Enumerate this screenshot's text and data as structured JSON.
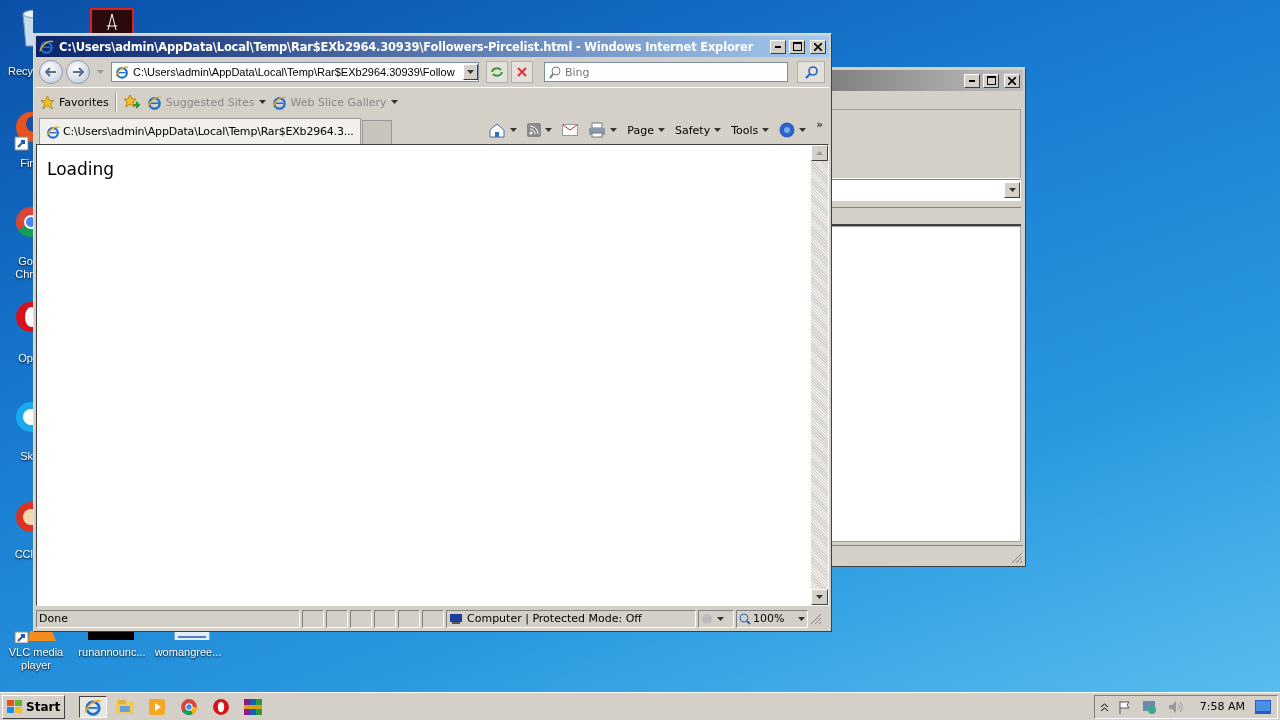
{
  "desktop_icons": [
    {
      "kind": "recycle",
      "label": "Recy"
    },
    {
      "kind": "acrobat"
    },
    {
      "kind": "firefox",
      "label": "Fir"
    },
    {
      "kind": "chrome",
      "label": "Go\nChr"
    },
    {
      "kind": "opera",
      "label": "Op"
    },
    {
      "kind": "skype",
      "label": "Sk"
    },
    {
      "kind": "ccleaner",
      "label": "CCl"
    },
    {
      "kind": "vlc",
      "label": "VLC media player"
    },
    {
      "kind": "thumb-dark",
      "label": "runannounc..."
    },
    {
      "kind": "thumb-light",
      "label": "womangree..."
    }
  ],
  "background_window": {
    "active": false
  },
  "ie_window": {
    "active": true,
    "title": "C:\\Users\\admin\\AppData\\Local\\Temp\\Rar$EXb2964.30939\\Followers-Pircelist.html - Windows Internet Explorer",
    "address": "C:\\Users\\admin\\AppData\\Local\\Temp\\Rar$EXb2964.30939\\Follow",
    "search_placeholder": "Bing",
    "favorites_bar": [
      {
        "kind": "favorites",
        "label": "Favorites"
      },
      {
        "kind": "link",
        "label": "Suggested Sites"
      },
      {
        "kind": "link",
        "label": "Web Slice Gallery"
      }
    ],
    "tabs": [
      {
        "kind": "page",
        "label": "C:\\Users\\admin\\AppData\\Local\\Temp\\Rar$EXb2964.3...",
        "selected": true
      },
      {
        "kind": "new",
        "selected": false
      }
    ],
    "command_bar": [
      {
        "kind": "home"
      },
      {
        "kind": "feeds"
      },
      {
        "kind": "mail"
      },
      {
        "kind": "print"
      },
      {
        "kind": "menu",
        "label": "Page"
      },
      {
        "kind": "menu",
        "label": "Safety"
      },
      {
        "kind": "menu",
        "label": "Tools"
      },
      {
        "kind": "help"
      },
      {
        "kind": "more",
        "label": "»"
      }
    ],
    "content": "Loading",
    "status_bar": {
      "text": "Done",
      "zone": "Computer | Protected Mode: Off",
      "zoom": "100%"
    }
  },
  "taskbar": {
    "start": "Start",
    "apps": [
      {
        "kind": "ie",
        "selected": true
      },
      {
        "kind": "explorer",
        "selected": false
      },
      {
        "kind": "media",
        "selected": false
      },
      {
        "kind": "chrome",
        "selected": false
      },
      {
        "kind": "opera",
        "selected": false
      },
      {
        "kind": "winrar",
        "selected": false
      }
    ],
    "clock": "7:58 AM"
  }
}
